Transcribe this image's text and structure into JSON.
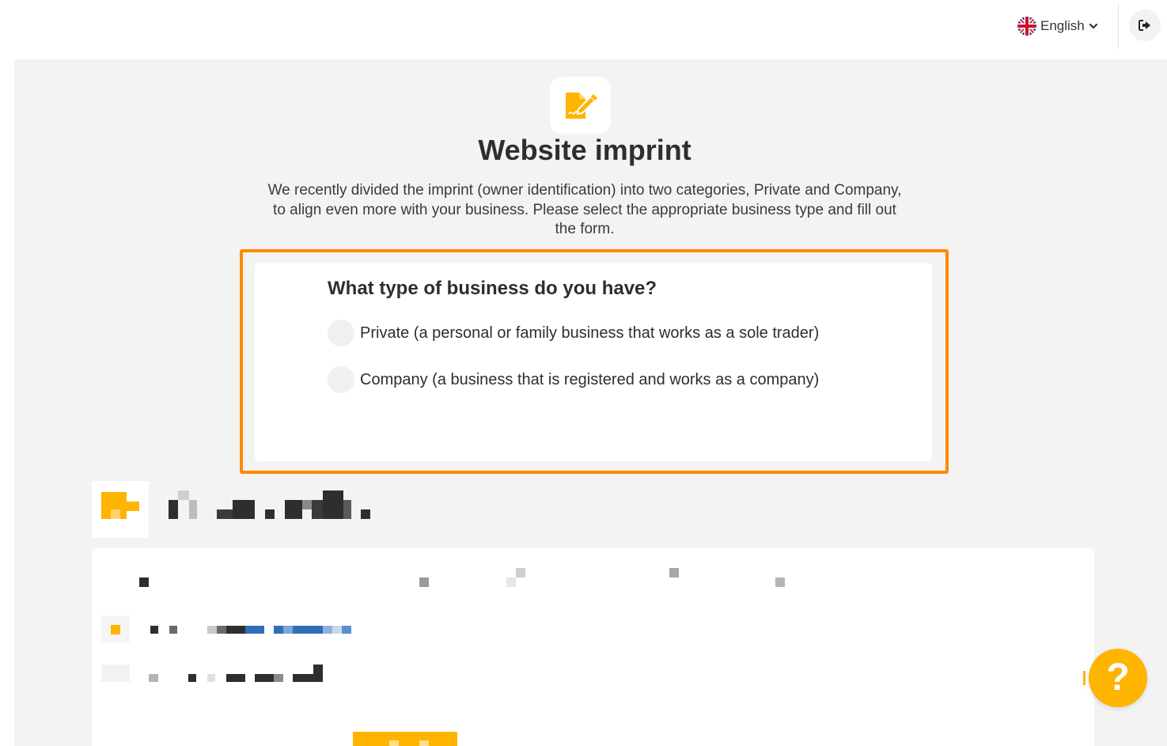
{
  "header": {
    "language_label": "English",
    "language_flag_icon": "uk-flag-icon",
    "language_chevron_icon": "chevron-down-icon",
    "logout_icon": "sign-out-icon"
  },
  "page": {
    "hero_icon": "signature-document-icon",
    "title": "Website imprint",
    "description": "We recently divided the imprint (owner identification) into two categories, Private and Company, to align even more with your business. Please select the appropriate business type and fill out the form."
  },
  "business_type": {
    "question": "What type of business do you have?",
    "options": [
      {
        "label": "Private (a personal or family business that works as a sole trader)",
        "selected": false
      },
      {
        "label": "Company (a business that is registered and works as a company)",
        "selected": false
      }
    ]
  },
  "help": {
    "label": "?"
  },
  "colors": {
    "accent_orange": "#ff8a00",
    "brand_yellow": "#ffb400",
    "background_gray": "#f3f3f3"
  }
}
